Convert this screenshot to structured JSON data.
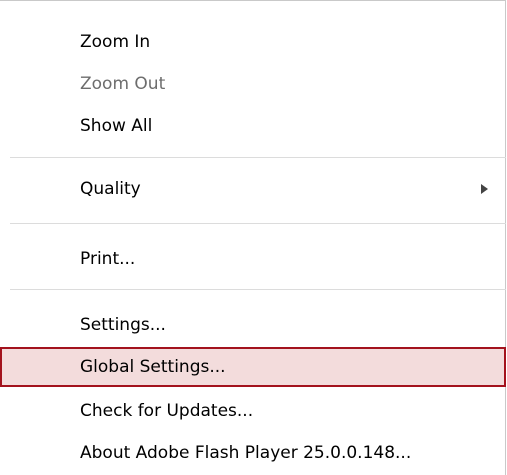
{
  "menu": {
    "items": [
      {
        "label": "Zoom In",
        "enabled": true
      },
      {
        "label": "Zoom Out",
        "enabled": false
      },
      {
        "label": "Show All",
        "enabled": true
      },
      {
        "label": "Quality",
        "enabled": true,
        "submenu": true
      },
      {
        "label": "Print...",
        "enabled": true
      },
      {
        "label": "Settings...",
        "enabled": true
      },
      {
        "label": "Global Settings...",
        "enabled": true,
        "highlighted": true
      },
      {
        "label": "Check for Updates...",
        "enabled": true
      },
      {
        "label": "About Adobe Flash Player 25.0.0.148...",
        "enabled": true
      }
    ],
    "highlight_color": "#f3dcdc",
    "highlight_border_color": "#a3121d",
    "disabled_text_color": "#6d6d6d"
  }
}
